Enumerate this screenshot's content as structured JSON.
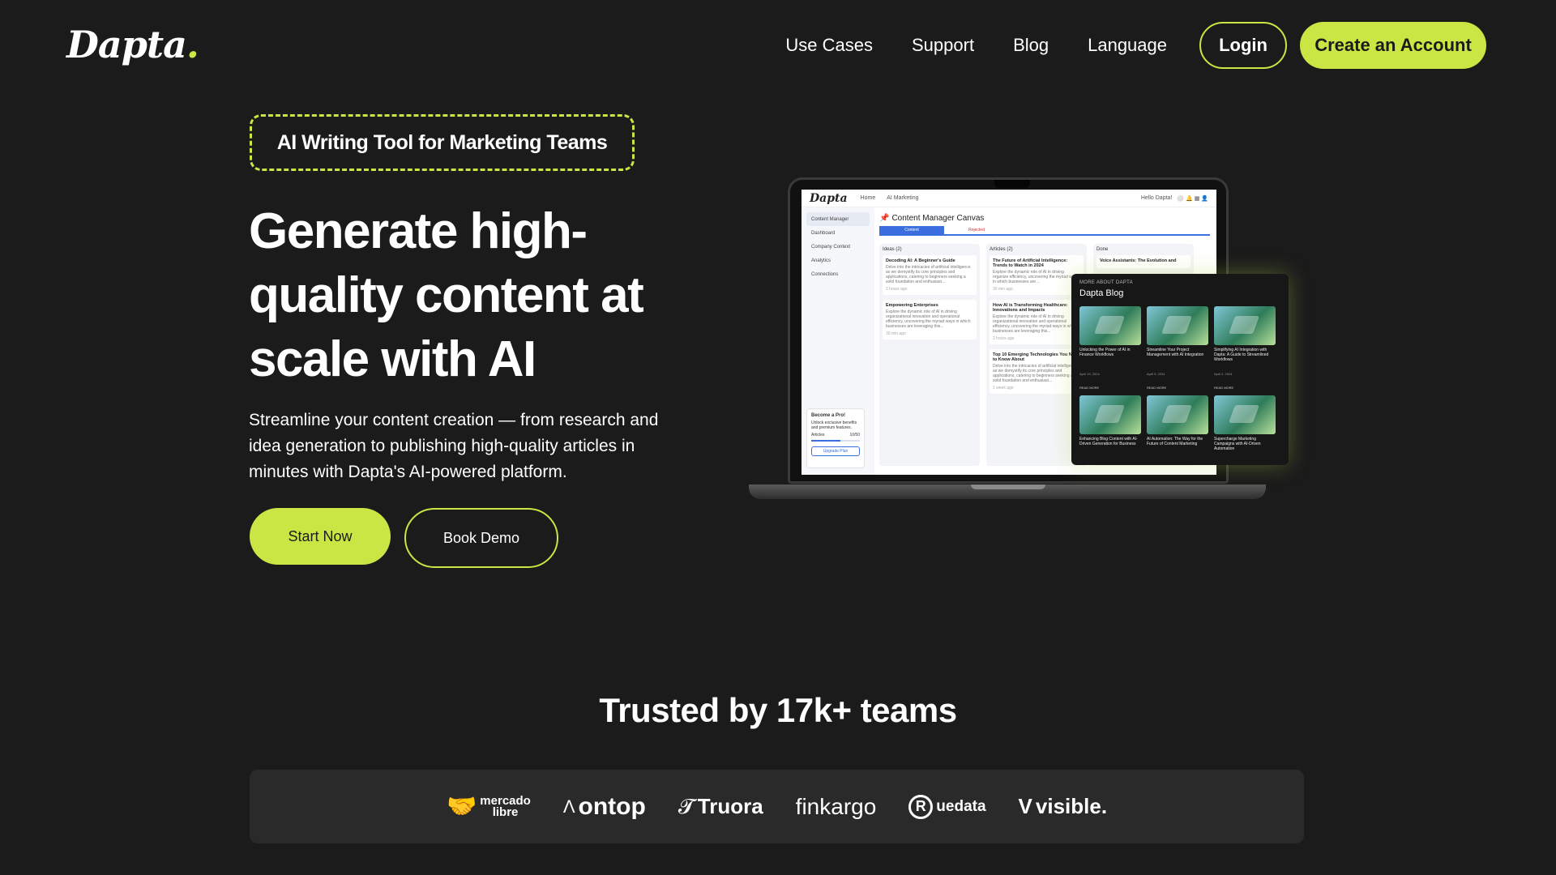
{
  "brand": {
    "logo_text": "Dapta",
    "logo_dot": "."
  },
  "nav": {
    "links": [
      "Use Cases",
      "Support",
      "Blog",
      "Language"
    ],
    "login": "Login",
    "create_account": "Create an Account"
  },
  "hero": {
    "tag": "AI Writing Tool for Marketing Teams",
    "headline": "Generate high-quality content at scale with AI",
    "subtext": "Streamline your content creation — from research and idea generation to publishing high-quality articles in minutes with Dapta's AI-powered platform.",
    "start_button": "Start Now",
    "demo_button": "Book Demo"
  },
  "app": {
    "logo": "Dapta",
    "breadcrumbs": [
      "Home",
      "AI Marketing"
    ],
    "greeting": "Hello Dapta!",
    "sidebar": [
      "Content Manager",
      "Dashboard",
      "Company Context",
      "Analytics",
      "Connections"
    ],
    "promo": {
      "title": "Become a Pro!",
      "text": "Unlock exclusive benefits and premium features.",
      "label": "Articles",
      "count": "10/50",
      "button": "Upgrade Plan"
    },
    "canvas_title": "Content Manager Canvas",
    "tabs": [
      "Content",
      "Rejected"
    ],
    "columns": [
      {
        "title": "Ideas (2)",
        "cards": [
          {
            "title": "Decoding AI: A Beginner's Guide",
            "text": "Delve into the intricacies of artificial intelligence as we demystify its core principles and applications, catering to beginners seeking a solid foundation and enthusiast...",
            "time": "2 hours ago"
          },
          {
            "title": "Empowering Enterprises",
            "text": "Explore the dynamic role of AI in driving organizational innovation and operational efficiency, uncovering the myriad ways in which businesses are leveraging this...",
            "time": "30 min ago"
          }
        ]
      },
      {
        "title": "Articles (2)",
        "cards": [
          {
            "title": "The Future of Artificial Intelligence: Trends to Watch in 2024",
            "text": "Explore the dynamic role of AI in driving organize efficiency, uncovering the myriad ways in which businesses are...",
            "time": "30 min ago"
          },
          {
            "title": "How AI is Transforming Healthcare: Innovations and Impacts",
            "text": "Explore the dynamic role of AI in driving organizational innovation and operational efficiency, uncovering the myriad ways in which businesses are leveraging this...",
            "time": "2 hours ago"
          },
          {
            "title": "Top 10 Emerging Technologies You Need to Know About",
            "text": "Delve into the intricacies of artificial intelligence as we demystify its core principles and applications, catering to beginners seeking a solid foundation and enthusiast...",
            "time": "1 week ago"
          }
        ]
      },
      {
        "title": "Done",
        "cards": [
          {
            "title": "Voice Assistants: The Evolution and",
            "text": "",
            "time": ""
          }
        ]
      }
    ]
  },
  "blog_panel": {
    "kicker": "MORE ABOUT DAPTA",
    "title": "Dapta Blog",
    "posts": [
      {
        "caption": "Unlocking the Power of AI in Finance Workflows",
        "date": "April 19, 2024",
        "more": "READ MORE"
      },
      {
        "caption": "Streamline Your Project Management with AI Integration",
        "date": "April 9, 2024",
        "more": "READ MORE"
      },
      {
        "caption": "Simplifying AI Integration with Dapta: A Guide to Streamlined Workflows",
        "date": "April 2, 2024",
        "more": "READ MORE"
      },
      {
        "caption": "Enhancing Blog Content with AI-Driven Generation for Business",
        "date": "",
        "more": ""
      },
      {
        "caption": "AI Automation: The Way for the Future of Content Marketing",
        "date": "",
        "more": ""
      },
      {
        "caption": "Supercharge Marketing Campaigns with AI-Driven Automation",
        "date": "",
        "more": ""
      }
    ]
  },
  "trusted": {
    "title": "Trusted by 17k+ teams",
    "logos": [
      {
        "name": "mercado libre",
        "line1": "mercado",
        "line2": "libre"
      },
      {
        "name": "ontop"
      },
      {
        "name": "Truora"
      },
      {
        "name": "finkargo"
      },
      {
        "name": "uedata",
        "mark": "R"
      },
      {
        "name": "visible."
      }
    ]
  },
  "colors": {
    "accent": "#c9e645",
    "background": "#1b1b1b",
    "panel": "#2a2a2a"
  }
}
